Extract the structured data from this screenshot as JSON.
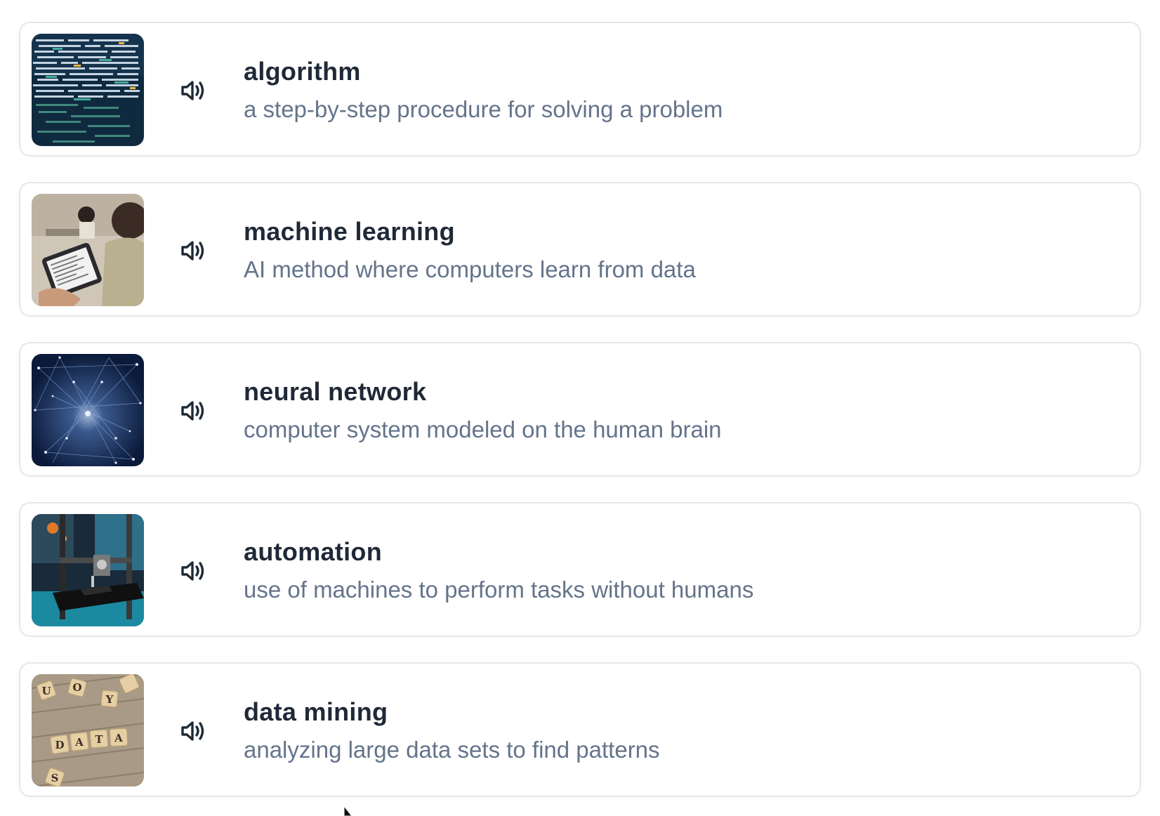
{
  "vocab_list": {
    "items": [
      {
        "word": "algorithm",
        "definition": "a step-by-step procedure for solving a problem",
        "image": "code-screen-photo",
        "audio_icon": "speaker-icon"
      },
      {
        "word": "machine learning",
        "definition": "AI method where computers learn from data",
        "image": "students-with-tablet-photo",
        "audio_icon": "speaker-icon"
      },
      {
        "word": "neural network",
        "definition": "computer system modeled on the human brain",
        "image": "network-nodes-photo",
        "audio_icon": "speaker-icon"
      },
      {
        "word": "automation",
        "definition": "use of machines to perform tasks without humans",
        "image": "3d-printer-photo",
        "audio_icon": "speaker-icon"
      },
      {
        "word": "data mining",
        "definition": "analyzing large data sets to find patterns",
        "image": "scrabble-tiles-data-photo",
        "audio_icon": "speaker-icon"
      }
    ]
  },
  "colors": {
    "word_text": "#1f2937",
    "definition_text": "#64748b",
    "card_border": "#e5e7eb",
    "icon": "#1f2937"
  }
}
